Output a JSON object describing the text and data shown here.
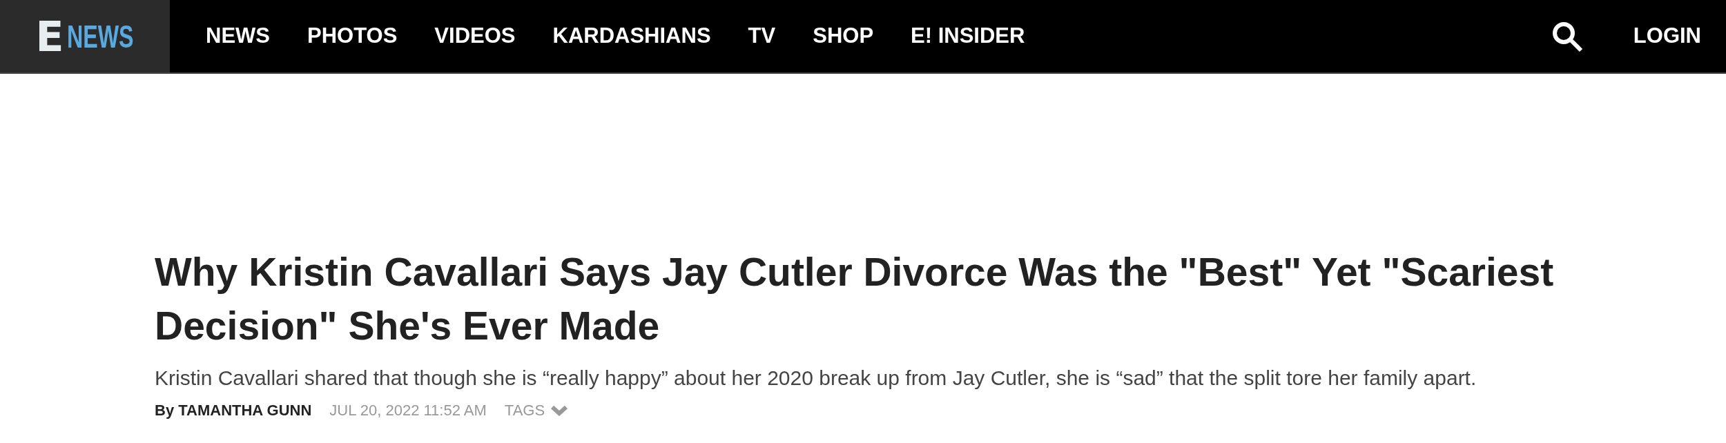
{
  "header": {
    "logo": {
      "mark": "E",
      "wordmark": "NEWS"
    },
    "nav": [
      {
        "label": "NEWS"
      },
      {
        "label": "PHOTOS"
      },
      {
        "label": "VIDEOS"
      },
      {
        "label": "KARDASHIANS"
      },
      {
        "label": "TV"
      },
      {
        "label": "SHOP"
      },
      {
        "label": "E! INSIDER"
      }
    ],
    "login": "LOGIN"
  },
  "article": {
    "title": "Why Kristin Cavallari Says Jay Cutler Divorce Was the \"Best\" Yet \"Scariest Decision\" She's Ever Made",
    "subtitle": "Kristin Cavallari shared that though she is “really happy” about her 2020 break up from Jay Cutler, she is “sad” that the split tore her family apart.",
    "byline": "By TAMANTHA GUNN",
    "date": "JUL 20, 2022 11:52 AM",
    "tags": "TAGS"
  }
}
